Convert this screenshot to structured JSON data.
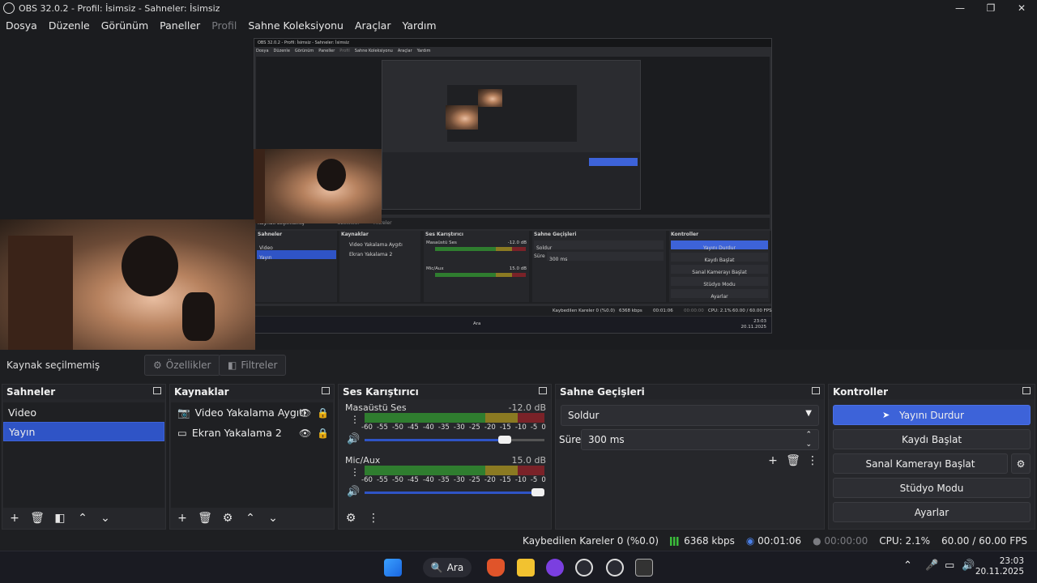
{
  "window": {
    "title": "OBS 32.0.2 - Profil: İsimsiz - Sahneler: İsimsiz",
    "controls": [
      "—",
      "❐",
      "✕"
    ]
  },
  "menu": [
    "Dosya",
    "Düzenle",
    "Görünüm",
    "Paneller",
    "Profil",
    "Sahne Koleksiyonu",
    "Araçlar",
    "Yardım"
  ],
  "nested": {
    "title": "OBS 32.0.2 - Profil: İsimsiz - Sahneler: İsimsiz",
    "menu": [
      "Dosya",
      "Düzenle",
      "Görünüm",
      "Paneller",
      "Profil",
      "Sahne Koleksiyonu",
      "Araçlar",
      "Yardım"
    ],
    "toolbar_text": "Kaynak seçilmemiş",
    "props": "Özellikler",
    "filters": "Filtreler",
    "docks": [
      "Sahneler",
      "Kaynaklar",
      "Ses Karıştırıcı",
      "Sahne Geçişleri",
      "Kontroller"
    ],
    "scenes": [
      "Video",
      "Yayın"
    ],
    "sources": [
      "Video Yakalama Aygıtı",
      "Ekran Yakalama 2"
    ],
    "mixer": [
      {
        "name": "Masaüstü Ses",
        "db": "-12.0 dB"
      },
      {
        "name": "Mic/Aux",
        "db": "15.0 dB"
      }
    ],
    "transition": "Soldur",
    "duration_label": "Süre",
    "duration": "300 ms",
    "controls": [
      "Yayını Durdur",
      "Kaydı Başlat",
      "Sanal Kamerayı Başlat",
      "Stüdyo Modu",
      "Ayarlar"
    ],
    "status": "Kaybedilen Kareler 0 (%0.0)",
    "kbps": "6368 kbps",
    "stream_time": "00:01:06",
    "rec_time": "00:00:00",
    "cpu": "CPU: 2.1%",
    "fps": "60.00 / 60.00 FPS",
    "search": "Ara",
    "time": "23:03",
    "date": "20.11.2025"
  },
  "toolbar": {
    "no_selection": "Kaynak seçilmemiş",
    "properties": "Özellikler",
    "filters": "Filtreler"
  },
  "docks": {
    "scenes": {
      "title": "Sahneler",
      "items": [
        {
          "label": "Video",
          "selected": false
        },
        {
          "label": "Yayın",
          "selected": true
        }
      ]
    },
    "sources": {
      "title": "Kaynaklar",
      "items": [
        {
          "label": "Video Yakalama Aygıtı",
          "icon": "camera-icon"
        },
        {
          "label": "Ekran Yakalama 2",
          "icon": "monitor-icon"
        }
      ]
    },
    "mixer": {
      "title": "Ses Karıştırıcı",
      "scale": [
        "-60",
        "-55",
        "-50",
        "-45",
        "-40",
        "-35",
        "-30",
        "-25",
        "-20",
        "-15",
        "-10",
        "-5",
        "0"
      ],
      "channels": [
        {
          "name": "Masaüstü Ses",
          "db": "-12.0 dB",
          "volume": 0.8
        },
        {
          "name": "Mic/Aux",
          "db": "15.0 dB",
          "volume": 1.0
        }
      ]
    },
    "transitions": {
      "title": "Sahne Geçişleri",
      "selected": "Soldur",
      "duration_label": "Süre",
      "duration": "300 ms"
    },
    "controls": {
      "title": "Kontroller",
      "stop_stream": "Yayını Durdur",
      "start_record": "Kaydı Başlat",
      "start_virtualcam": "Sanal Kamerayı Başlat",
      "studio_mode": "Stüdyo Modu",
      "settings": "Ayarlar"
    }
  },
  "status": {
    "dropped_frames": "Kaybedilen Kareler 0 (%0.0)",
    "bitrate": "6368 kbps",
    "stream_time": "00:01:06",
    "record_time": "00:00:00",
    "cpu": "CPU: 2.1%",
    "fps": "60.00 / 60.00 FPS"
  },
  "taskbar": {
    "search": "Ara",
    "time": "23:03",
    "date": "20.11.2025"
  },
  "colors": {
    "accent": "#3d63d9",
    "selected": "#2f54c6",
    "meter_green": "#2f7d2f",
    "meter_yellow": "#8b7a22",
    "meter_red": "#7a2228"
  }
}
